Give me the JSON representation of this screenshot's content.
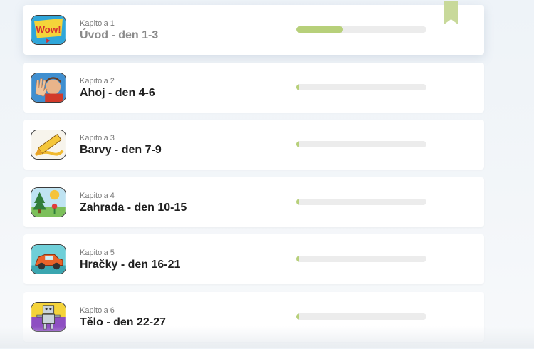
{
  "chapters": [
    {
      "label": "Kapitola 1",
      "title": "Úvod - den 1-3",
      "progress": 0.36,
      "thumb_icon": "wow-icon",
      "active": true
    },
    {
      "label": "Kapitola 2",
      "title": "Ahoj - den 4-6",
      "progress": 0.02,
      "thumb_icon": "waving-teacher-icon"
    },
    {
      "label": "Kapitola 3",
      "title": "Barvy - den 7-9",
      "progress": 0.02,
      "thumb_icon": "crayon-icon"
    },
    {
      "label": "Kapitola 4",
      "title": "Zahrada - den 10-15",
      "progress": 0.02,
      "thumb_icon": "garden-icon"
    },
    {
      "label": "Kapitola 5",
      "title": "Hračky - den 16-21",
      "progress": 0.02,
      "thumb_icon": "toy-car-icon"
    },
    {
      "label": "Kapitola 6",
      "title": "Tělo - den 22-27",
      "progress": 0.02,
      "thumb_icon": "robot-body-icon"
    }
  ],
  "colors": {
    "progress_fill": "#b7d07a",
    "progress_track": "#ececec",
    "bookmark": "#c8d99a"
  }
}
